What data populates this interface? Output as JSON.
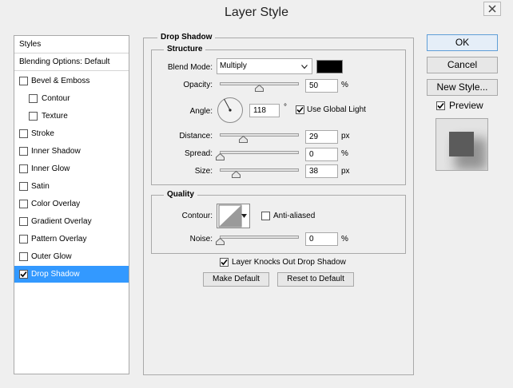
{
  "window": {
    "title": "Layer Style"
  },
  "sidebar": {
    "header": "Styles",
    "blending": "Blending Options: Default",
    "items": [
      {
        "label": "Bevel & Emboss",
        "checked": false
      },
      {
        "label": "Contour",
        "checked": false
      },
      {
        "label": "Texture",
        "checked": false
      },
      {
        "label": "Stroke",
        "checked": false
      },
      {
        "label": "Inner Shadow",
        "checked": false
      },
      {
        "label": "Inner Glow",
        "checked": false
      },
      {
        "label": "Satin",
        "checked": false
      },
      {
        "label": "Color Overlay",
        "checked": false
      },
      {
        "label": "Gradient Overlay",
        "checked": false
      },
      {
        "label": "Pattern Overlay",
        "checked": false
      },
      {
        "label": "Outer Glow",
        "checked": false
      },
      {
        "label": "Drop Shadow",
        "checked": true
      }
    ]
  },
  "drop_shadow": {
    "title": "Drop Shadow",
    "structure": {
      "title": "Structure",
      "blend_mode_label": "Blend Mode:",
      "blend_mode_value": "Multiply",
      "shadow_color": "#000000",
      "opacity_label": "Opacity:",
      "opacity_value": "50",
      "opacity_unit": "%",
      "opacity_level": 0.5,
      "angle_label": "Angle:",
      "angle_value": "118",
      "angle_unit": "°",
      "global_light_label": "Use Global Light",
      "global_light_checked": true,
      "distance_label": "Distance:",
      "distance_value": "29",
      "distance_unit": "px",
      "spread_label": "Spread:",
      "spread_value": "0",
      "spread_unit": "%",
      "size_label": "Size:",
      "size_value": "38",
      "size_unit": "px"
    },
    "quality": {
      "title": "Quality",
      "contour_label": "Contour:",
      "anti_aliased_label": "Anti-aliased",
      "anti_aliased_checked": false,
      "noise_label": "Noise:",
      "noise_value": "0",
      "noise_unit": "%"
    },
    "knocks_out_label": "Layer Knocks Out Drop Shadow",
    "knocks_out_checked": true,
    "make_default_label": "Make Default",
    "reset_default_label": "Reset to Default"
  },
  "buttons": {
    "ok": "OK",
    "cancel": "Cancel",
    "new_style": "New Style...",
    "preview_label": "Preview",
    "preview_checked": true
  },
  "colors": {
    "selection": "#3399ff",
    "preview_swatch": "#5b5b5b"
  }
}
